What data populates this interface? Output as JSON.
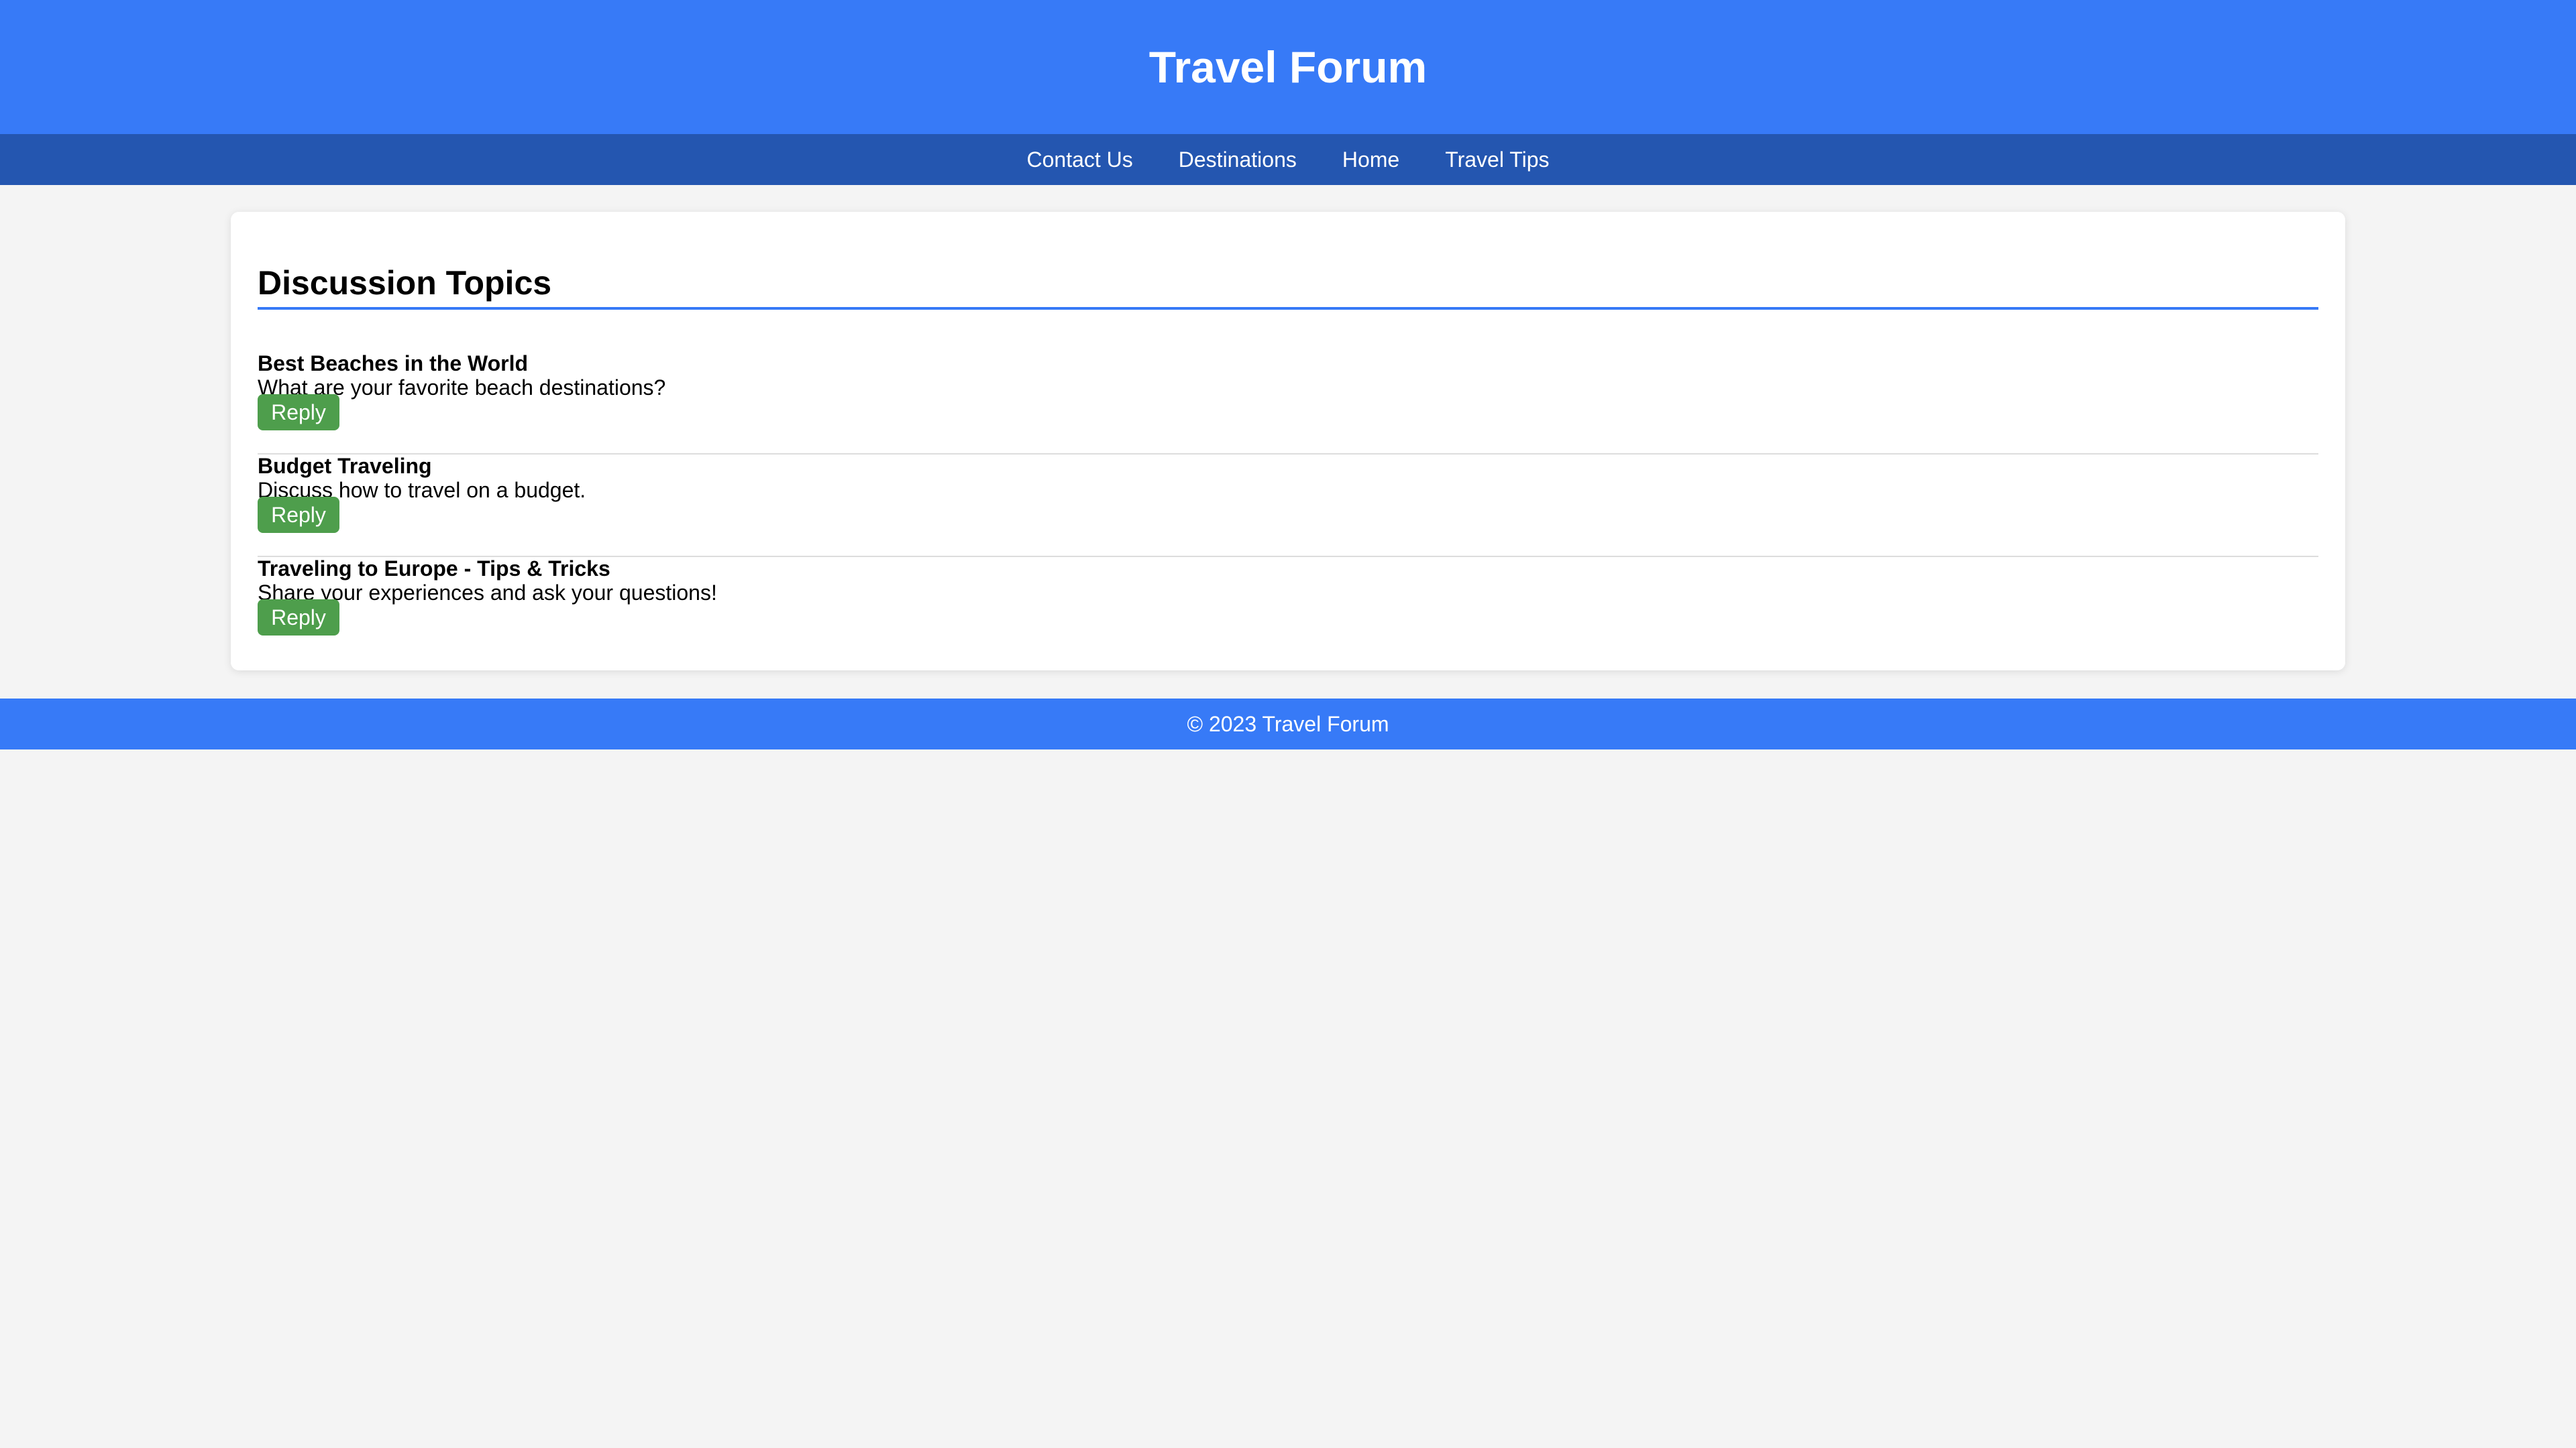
{
  "header": {
    "title": "Travel Forum"
  },
  "nav": {
    "items": [
      {
        "label": "Contact Us"
      },
      {
        "label": "Destinations"
      },
      {
        "label": "Home"
      },
      {
        "label": "Travel Tips"
      }
    ]
  },
  "main": {
    "section_title": "Discussion Topics",
    "topics": [
      {
        "title": "Best Beaches in the World",
        "description": "What are your favorite beach destinations?",
        "reply_label": "Reply"
      },
      {
        "title": "Budget Traveling",
        "description": "Discuss how to travel on a budget.",
        "reply_label": "Reply"
      },
      {
        "title": "Traveling to Europe - Tips & Tricks",
        "description": "Share your experiences and ask your questions!",
        "reply_label": "Reply"
      }
    ]
  },
  "footer": {
    "text": "© 2023 Travel Forum"
  },
  "colors": {
    "header_bg": "#377af7",
    "nav_bg": "#2456b0",
    "reply_button_bg": "#4e9e4c",
    "page_bg": "#f4f4f4"
  }
}
